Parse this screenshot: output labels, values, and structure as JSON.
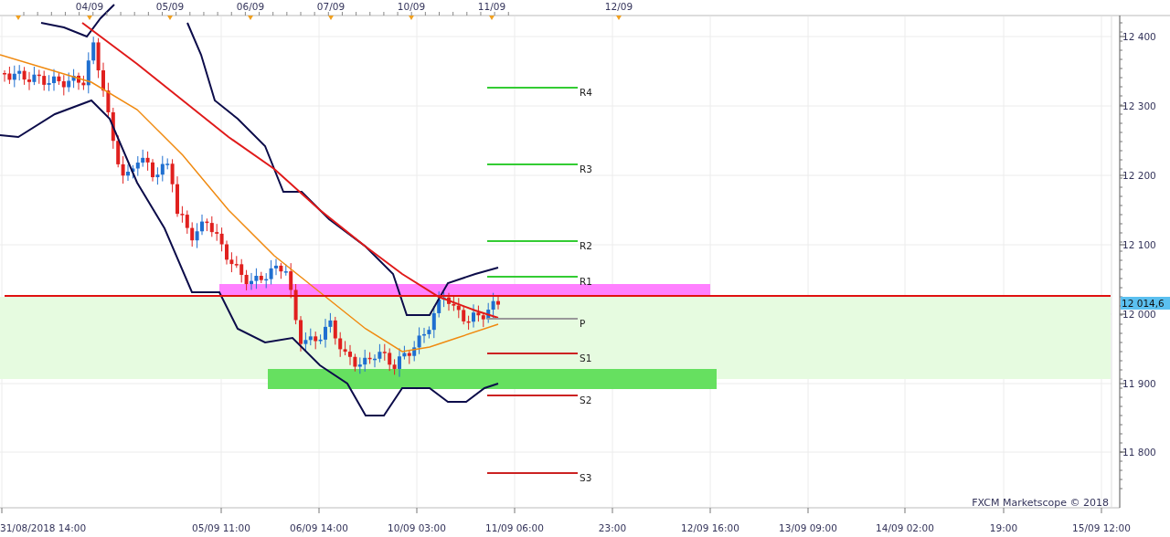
{
  "top_axis": {
    "labels": [
      "04/09",
      "05/09",
      "06/09",
      "07/09",
      "10/09",
      "11/09",
      "12/09"
    ]
  },
  "price_axis": {
    "ticks": [
      "12 400",
      "12 300",
      "12 200",
      "12 100",
      "12 000",
      "11 900",
      "11 800"
    ],
    "current_price": "12 014,6"
  },
  "pivot_levels": [
    {
      "label": "R4",
      "color": "#33cc33"
    },
    {
      "label": "R3",
      "color": "#33cc33"
    },
    {
      "label": "R2",
      "color": "#33cc33"
    },
    {
      "label": "R1",
      "color": "#33cc33"
    },
    {
      "label": "P",
      "color": "#999999"
    },
    {
      "label": "S1",
      "color": "#cc2222"
    },
    {
      "label": "S2",
      "color": "#cc2222"
    },
    {
      "label": "S3",
      "color": "#cc2222"
    }
  ],
  "time_axis": {
    "labels": [
      "31/08/2018 14:00",
      "05/09 11:00",
      "06/09 14:00",
      "10/09 03:00",
      "11/09 06:00",
      "23:00",
      "12/09 16:00",
      "13/09 09:00",
      "14/09 02:00",
      "19:00",
      "15/09 12:00"
    ]
  },
  "watermark": "FXCM Marketscope © 2018"
}
